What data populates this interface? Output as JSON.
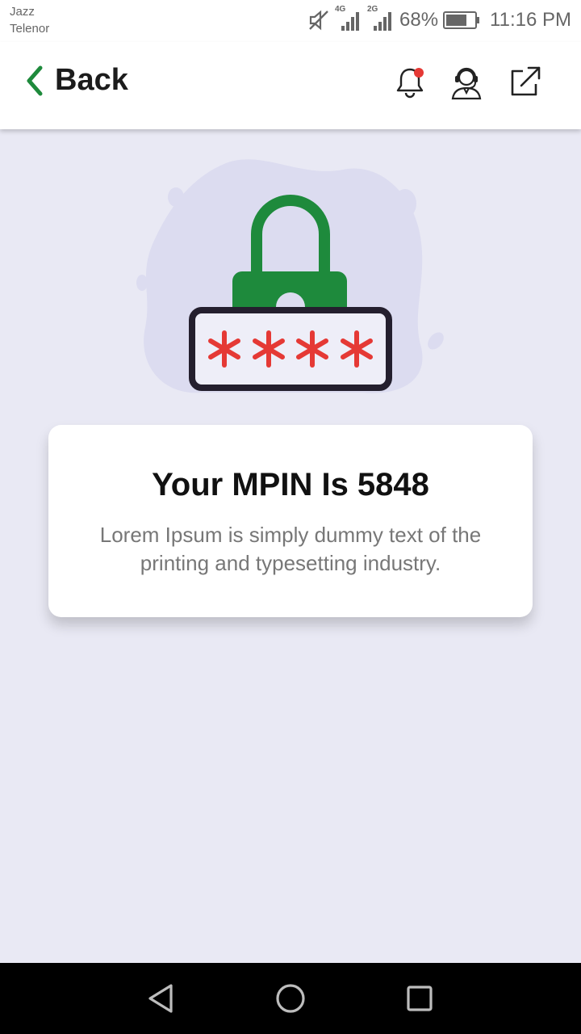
{
  "status_bar": {
    "carrier_1": "Jazz",
    "carrier_2": "Telenor",
    "network_1": "4G",
    "network_2": "2G",
    "battery_percent": "68%",
    "time": "11:16 PM"
  },
  "header": {
    "back_label": "Back",
    "accent_color": "#1e8a3c",
    "notification_dot_color": "#e53935"
  },
  "illustration": {
    "masked_pin": "****",
    "lock_color": "#1e8a3c",
    "asterisk_color": "#e53935"
  },
  "card": {
    "title": "Your MPIN Is 5848",
    "description": "Lorem Ipsum is simply dummy text of the printing and typesetting industry."
  },
  "icons": {
    "back": "chevron-left-icon",
    "notifications": "bell-icon",
    "support": "support-agent-icon",
    "share": "external-link-icon",
    "nav_back": "triangle-back-icon",
    "nav_home": "circle-home-icon",
    "nav_recents": "square-recents-icon"
  }
}
